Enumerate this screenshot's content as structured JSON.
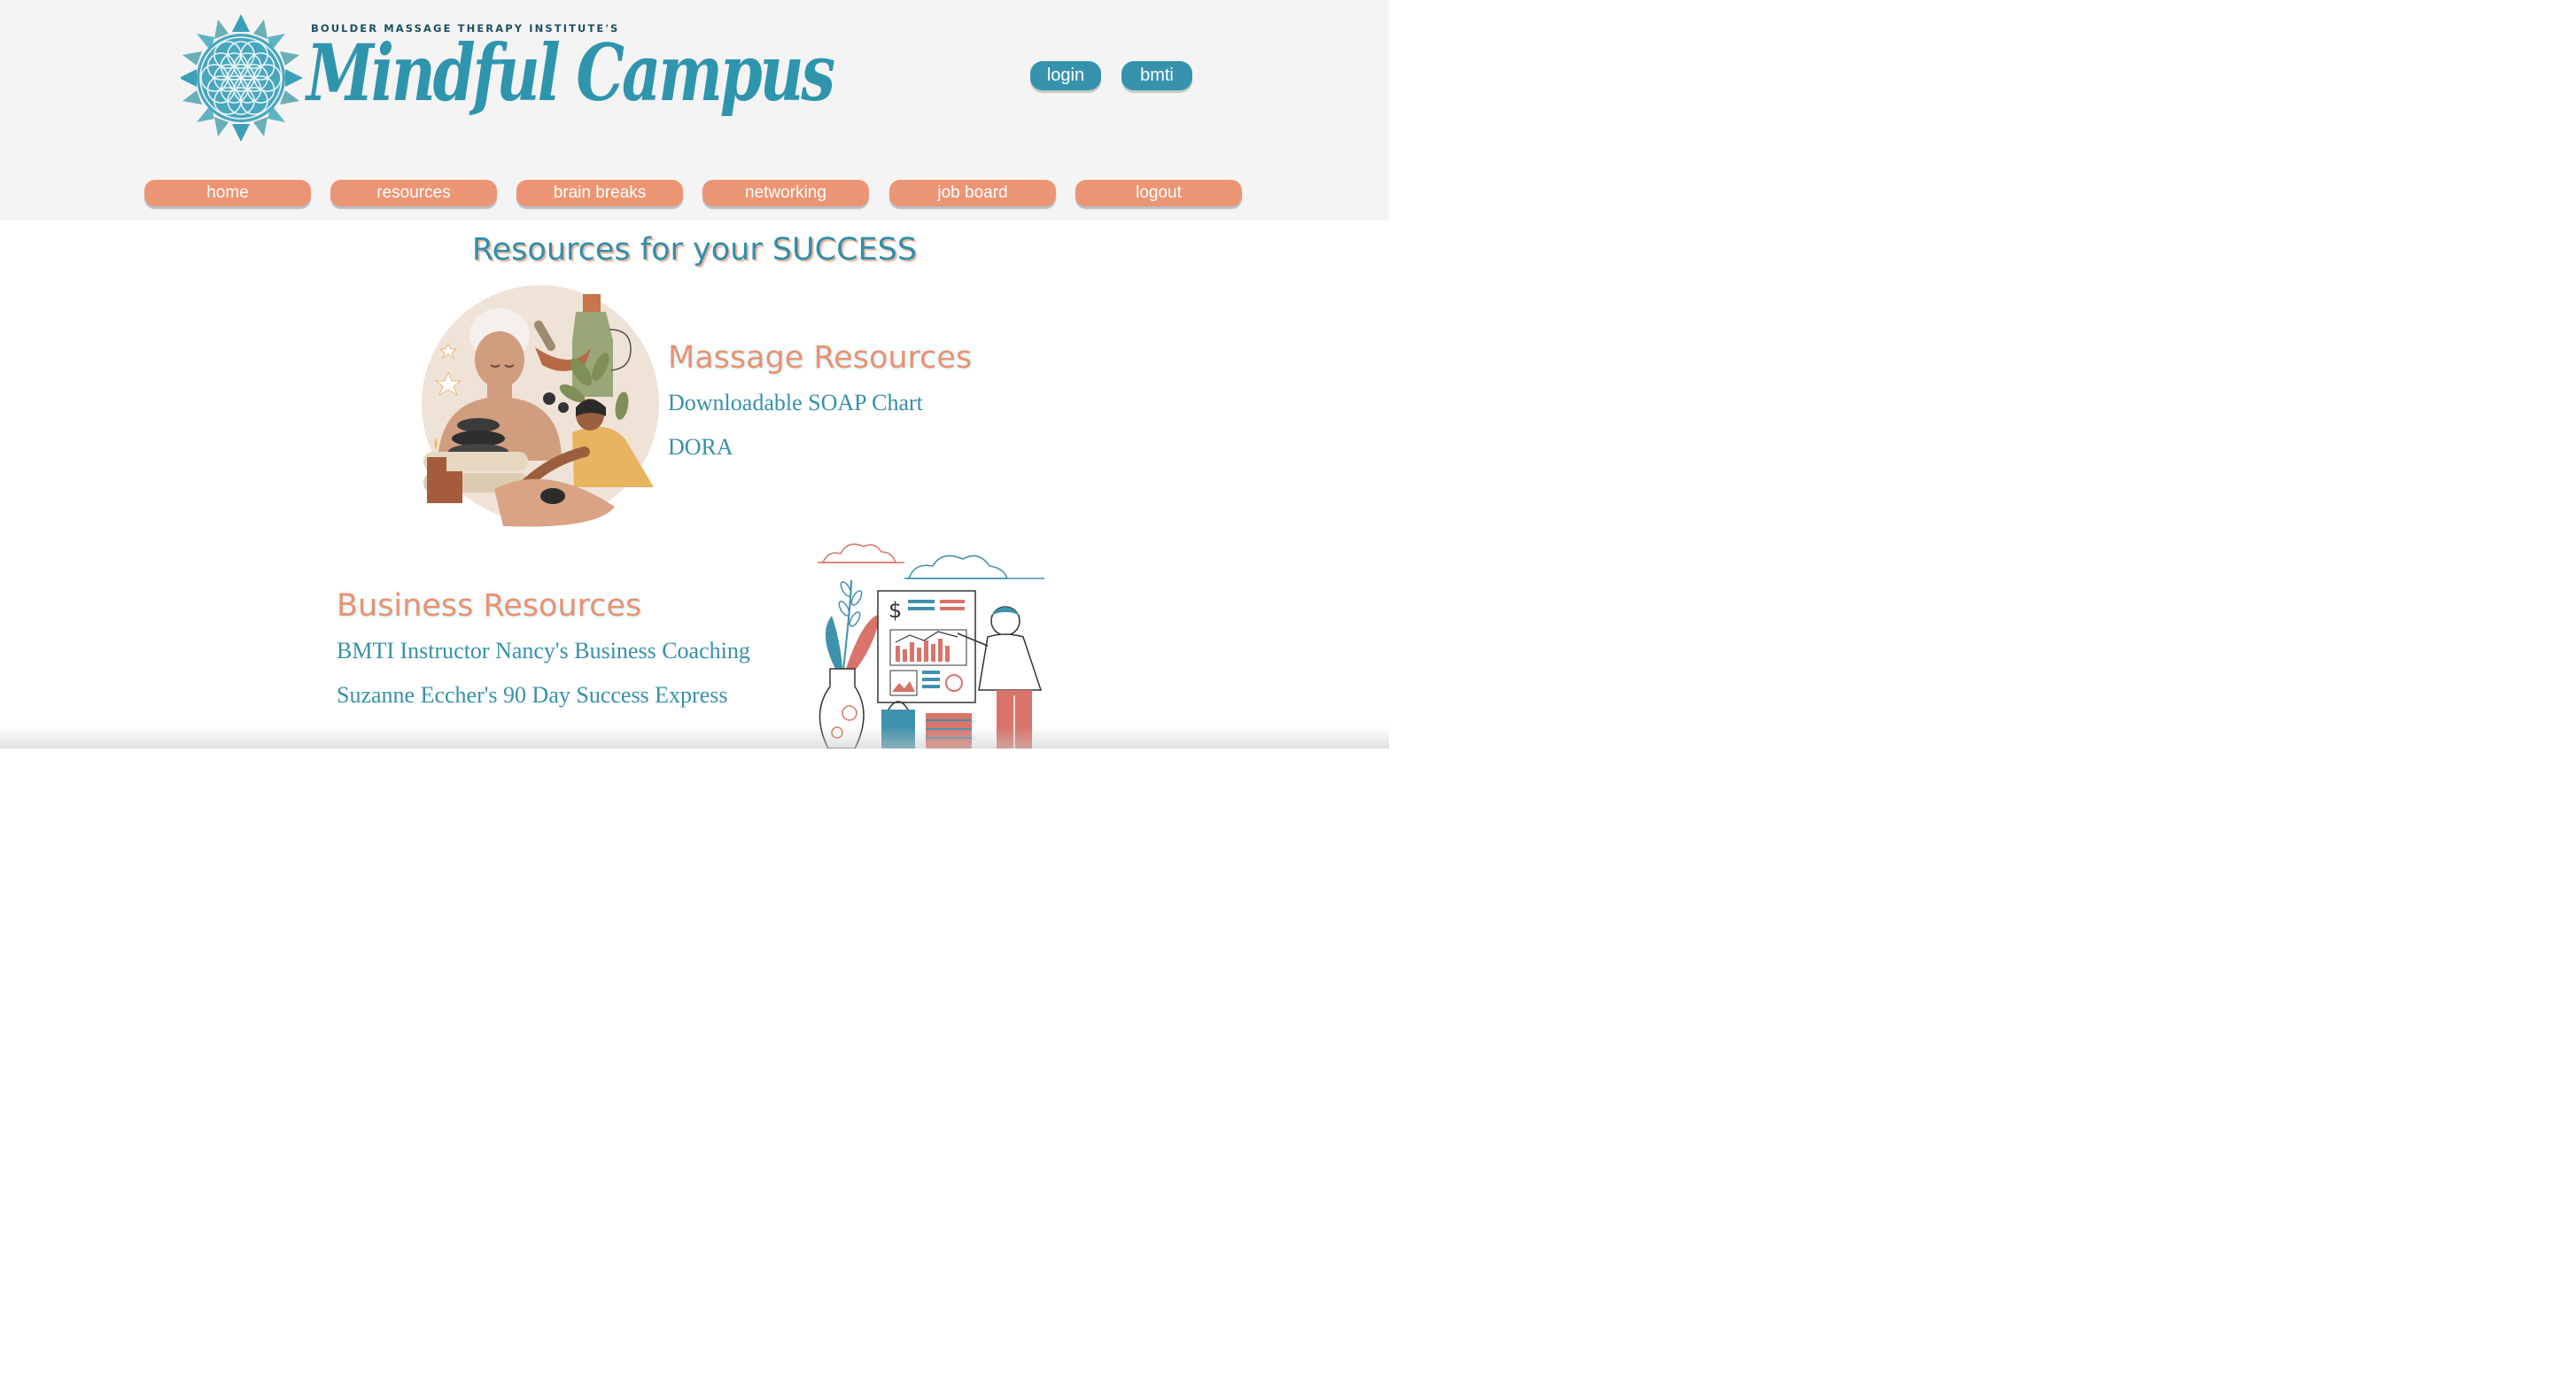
{
  "header": {
    "logo_superscript": "BOULDER MASSAGE THERAPY INSTITUTE'S",
    "logo_title": "Mindful Campus",
    "login_label": "login",
    "bmti_label": "bmti"
  },
  "nav": {
    "items": [
      "home",
      "resources",
      "brain breaks",
      "networking",
      "job board",
      "logout"
    ]
  },
  "main": {
    "page_title": "Resources for your SUCCESS",
    "massage": {
      "heading": "Massage Resources",
      "links": [
        "Downloadable SOAP Chart",
        "DORA"
      ]
    },
    "business": {
      "heading": "Business Resources",
      "links": [
        "BMTI Instructor Nancy's Business Coaching",
        "Suzanne Eccher's 90 Day Success Express"
      ]
    }
  },
  "colors": {
    "brand_teal": "#3793ad",
    "nav_salmon": "#ec9574",
    "header_bg": "#f4f4f4"
  },
  "icons": [
    "flower-of-life-logo-icon",
    "massage-illustration",
    "business-illustration"
  ]
}
